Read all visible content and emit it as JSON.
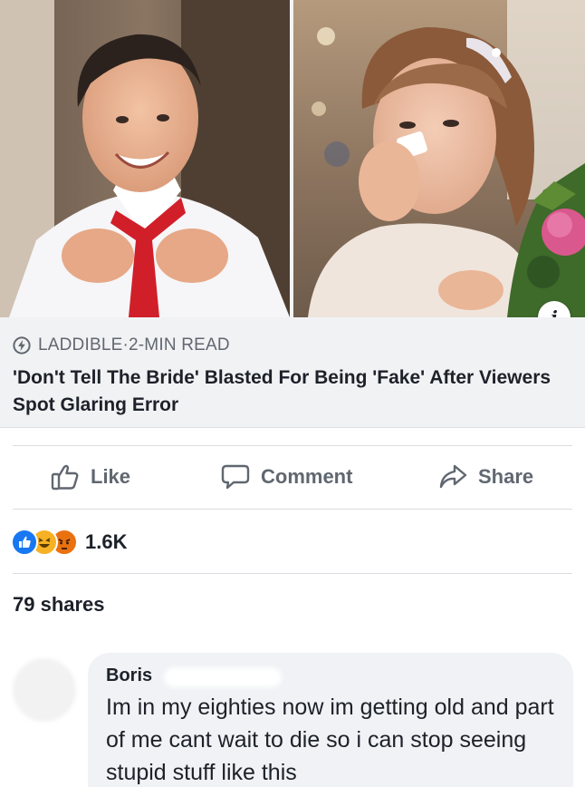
{
  "post": {
    "source": "LADDIBLE",
    "separator": "·",
    "read_time": "2-MIN READ",
    "headline": "'Don't Tell The Bride' Blasted For Being 'Fake' After Viewers Spot Glaring Error",
    "info_icon": "i"
  },
  "actions": {
    "like_label": "Like",
    "comment_label": "Comment",
    "share_label": "Share"
  },
  "reactions": {
    "types": [
      "like",
      "haha",
      "angry"
    ],
    "count": "1.6K"
  },
  "shares": "79 shares",
  "comment": {
    "author": "Boris",
    "text": "Im in my eighties now im getting old and part of me cant wait to die so i can stop seeing stupid stuff like this"
  },
  "colors": {
    "facebook_blue": "#1877f2",
    "haha_yellow": "#f7b125",
    "angry_orange": "#e9710f",
    "muted_text": "#606770",
    "caption_bg": "#f1f2f4",
    "bubble_bg": "#f0f2f5"
  }
}
